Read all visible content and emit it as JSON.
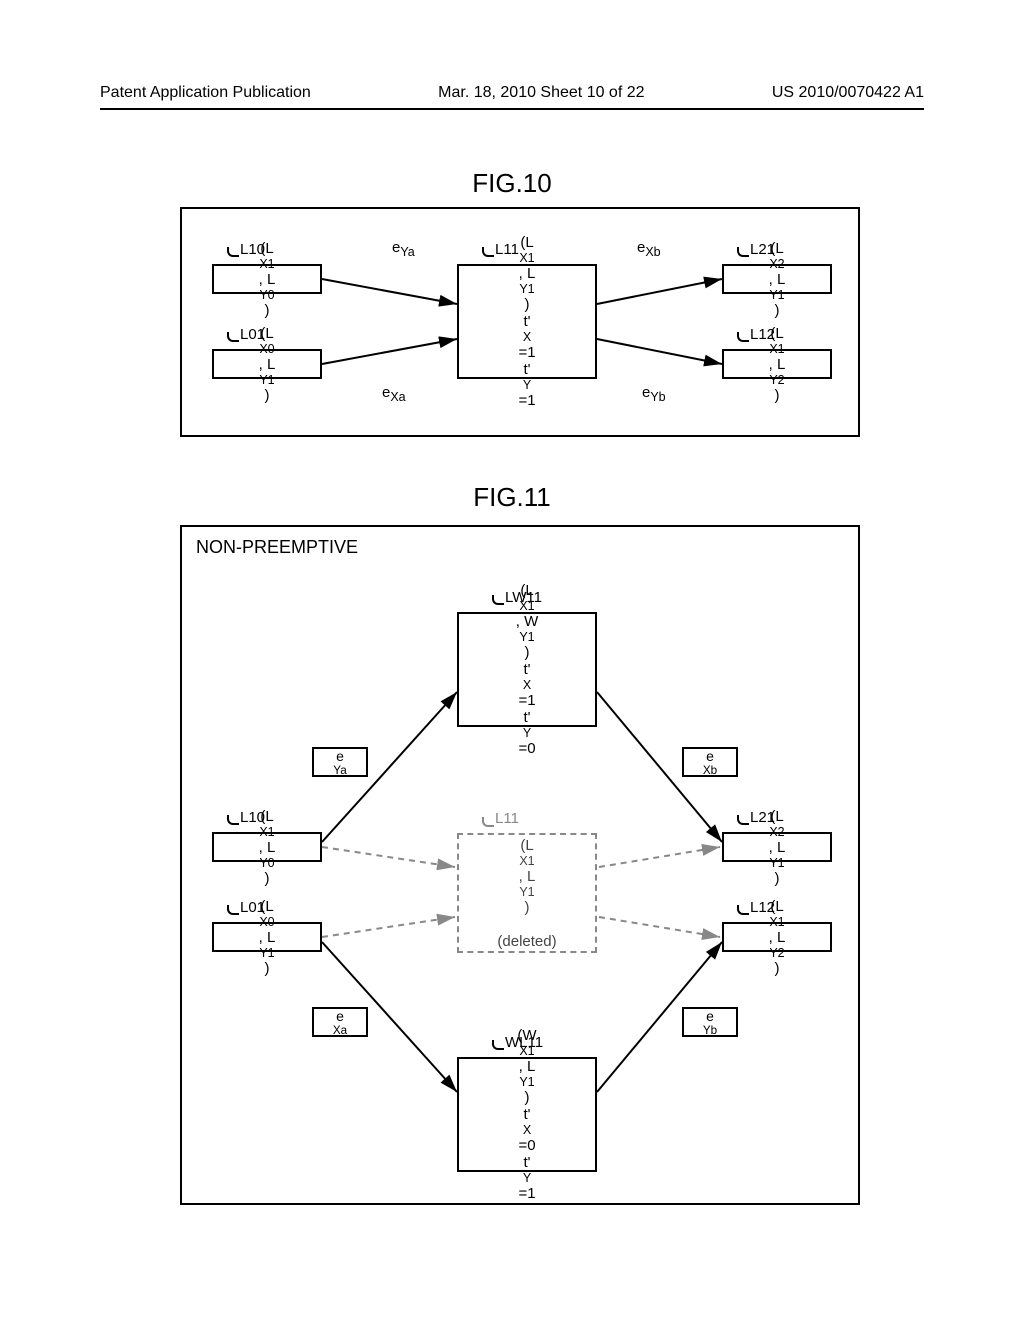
{
  "header": {
    "left": "Patent Application Publication",
    "center": "Mar. 18, 2010   Sheet 10 of 22",
    "right": "US 2010/0070422 A1"
  },
  "fig10": {
    "title": "FIG.10",
    "nodes": {
      "L10": {
        "id": "L10",
        "content_html": "(L<sub>X1</sub>, L<sub>Y0</sub>)"
      },
      "L01": {
        "id": "L01",
        "content_html": "(L<sub>X0</sub>, L<sub>Y1</sub>)"
      },
      "L11": {
        "id": "L11",
        "content_html": "(L<sub>X1</sub>, L<sub>Y1</sub>)<br>t'<sub>X</sub>=1<br>t'<sub>Y</sub>=1"
      },
      "L21": {
        "id": "L21",
        "content_html": "(L<sub>X2</sub>, L<sub>Y1</sub>)"
      },
      "L12": {
        "id": "L12",
        "content_html": "(L<sub>X1</sub>, L<sub>Y2</sub>)"
      }
    },
    "edges": {
      "eYa_html": "e<sub>Ya</sub>",
      "eXa_html": "e<sub>Xa</sub>",
      "eXb_html": "e<sub>Xb</sub>",
      "eYb_html": "e<sub>Yb</sub>"
    }
  },
  "fig11": {
    "title": "FIG.11",
    "header_label": "NON-PREEMPTIVE",
    "nodes": {
      "LW11": {
        "id": "LW11",
        "content_html": "(L<sub>X1</sub>, W<sub>Y1</sub>)<br>t'<sub>X</sub>=1<br>t'<sub>Y</sub>=0"
      },
      "L10": {
        "id": "L10",
        "content_html": "(L<sub>X1</sub>, L<sub>Y0</sub>)"
      },
      "L01": {
        "id": "L01",
        "content_html": "(L<sub>X0</sub>, L<sub>Y1</sub>)"
      },
      "L11": {
        "id": "L11",
        "content_html": "(L<sub>X1</sub>, L<sub>Y1</sub>)<br><br>(deleted)"
      },
      "L21": {
        "id": "L21",
        "content_html": "(L<sub>X2</sub>, L<sub>Y1</sub>)"
      },
      "L12": {
        "id": "L12",
        "content_html": "(L<sub>X1</sub>, L<sub>Y2</sub>)"
      },
      "WL11": {
        "id": "WL11",
        "content_html": "(W<sub>X1</sub>, L<sub>Y1</sub>)<br>t'<sub>X</sub>=0<br>t'<sub>Y</sub>=1"
      }
    },
    "edges": {
      "eYa_html": "e<sub>Ya</sub>",
      "eXa_html": "e<sub>Xa</sub>",
      "eXb_html": "e<sub>Xb</sub>",
      "eYb_html": "e<sub>Yb</sub>"
    }
  }
}
